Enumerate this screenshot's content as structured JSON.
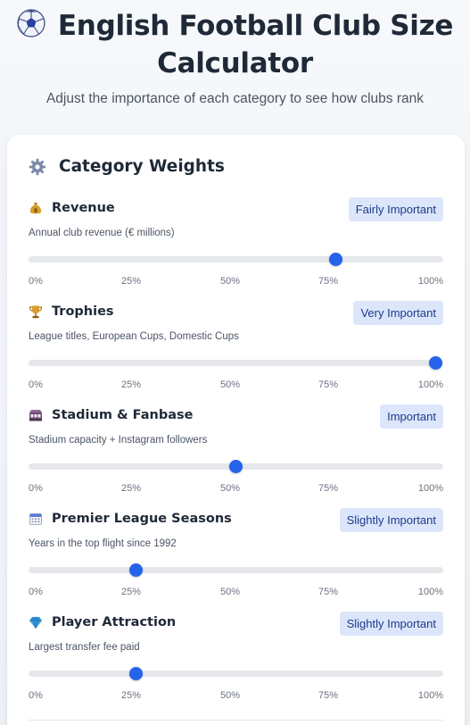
{
  "header": {
    "icon": "soccer-ball-icon",
    "title_line1": "English Football Club Size",
    "title_line2": "Calculator",
    "subtitle": "Adjust the importance of each category to see how clubs rank"
  },
  "weights_card": {
    "icon": "gear-icon",
    "title": "Category Weights",
    "tick_labels": [
      "0%",
      "25%",
      "50%",
      "75%",
      "100%"
    ],
    "categories": [
      {
        "name": "Revenue",
        "icon": "money-bag-icon",
        "description": "Annual club revenue (€ millions)",
        "importance": "Fairly Important",
        "value_percent": 75
      },
      {
        "name": "Trophies",
        "icon": "trophy-icon",
        "description": "League titles, European Cups, Domestic Cups",
        "importance": "Very Important",
        "value_percent": 100
      },
      {
        "name": "Stadium & Fanbase",
        "icon": "stadium-icon",
        "description": "Stadium capacity + Instagram followers",
        "importance": "Important",
        "value_percent": 50
      },
      {
        "name": "Premier League Seasons",
        "icon": "calendar-icon",
        "description": "Years in the top flight since 1992",
        "importance": "Slightly Important",
        "value_percent": 25
      },
      {
        "name": "Player Attraction",
        "icon": "gem-icon",
        "description": "Largest transfer fee paid",
        "importance": "Slightly Important",
        "value_percent": 25
      }
    ]
  },
  "colors": {
    "accent": "#2563eb",
    "badge_bg": "#dbe6fb",
    "badge_text": "#1e3a8a",
    "track": "#e5e7eb"
  }
}
